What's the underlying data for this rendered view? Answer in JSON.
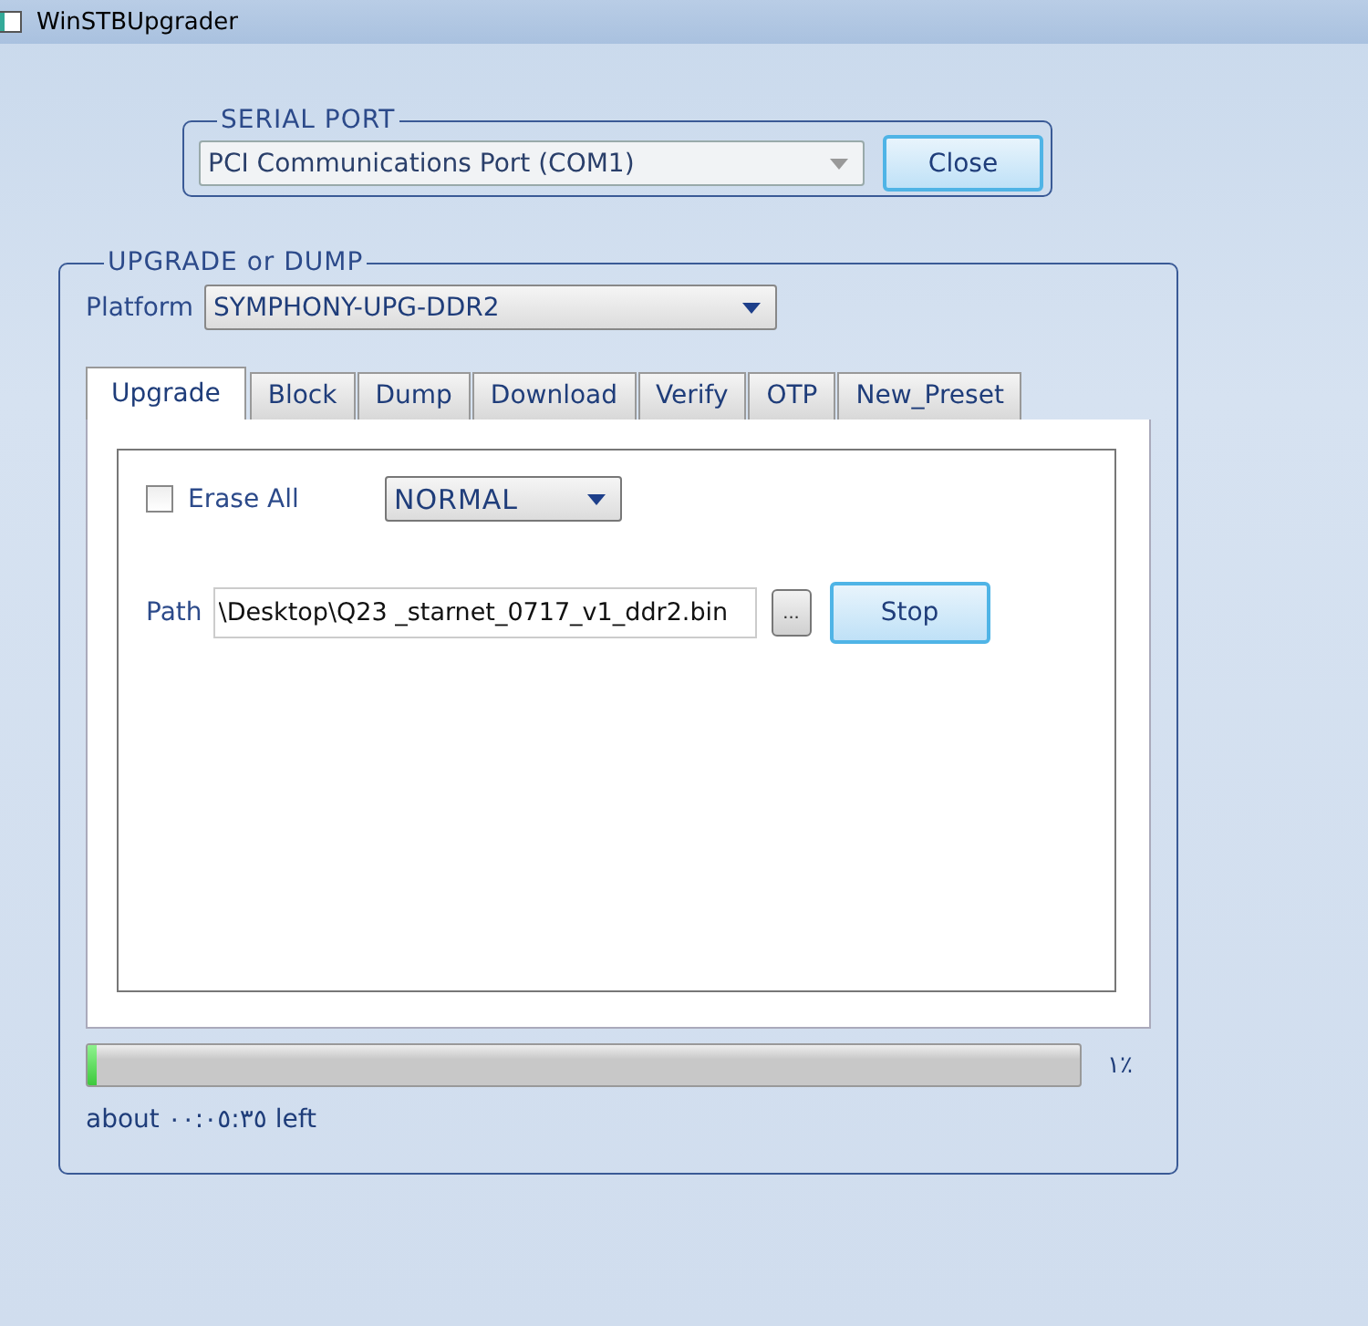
{
  "window": {
    "title": "WinSTBUpgrader"
  },
  "serial_port": {
    "legend": "SERIAL PORT",
    "port": "PCI Communications Port (COM1)",
    "button": "Close"
  },
  "upgrade": {
    "legend": "UPGRADE or DUMP",
    "platform_label": "Platform",
    "platform": "SYMPHONY-UPG-DDR2",
    "tabs": [
      {
        "label": "Upgrade",
        "selected": true
      },
      {
        "label": "Block",
        "selected": false
      },
      {
        "label": "Dump",
        "selected": false
      },
      {
        "label": "Download",
        "selected": false
      },
      {
        "label": "Verify",
        "selected": false
      },
      {
        "label": "OTP",
        "selected": false
      },
      {
        "label": "New_Preset",
        "selected": false
      }
    ],
    "erase_all": {
      "label": "Erase All",
      "checked": false
    },
    "mode": "NORMAL",
    "path_label": "Path",
    "path": "\\Desktop\\Q23 _starnet_0717_v1_ddr2.bin",
    "browse_button": "...",
    "stop_button": "Stop",
    "progress": {
      "level": 0.01,
      "reading": "١٪"
    },
    "time_left": "about ٠٠:٠٥:٣٥ left"
  }
}
